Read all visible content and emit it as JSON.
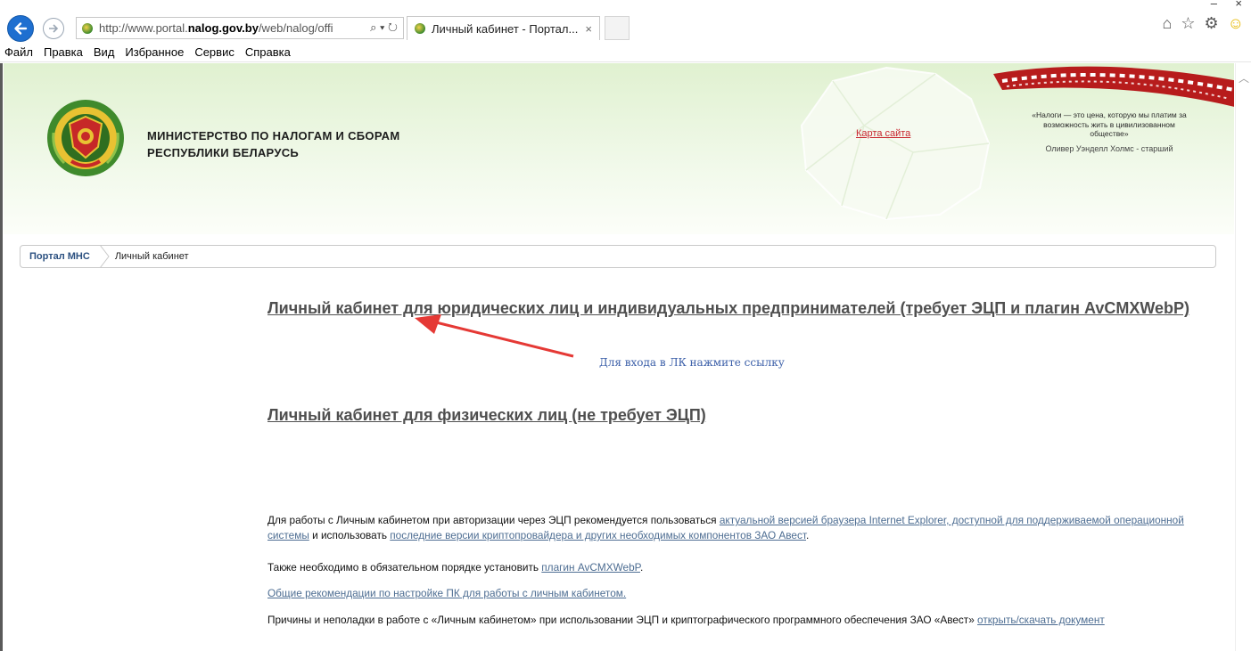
{
  "browser": {
    "address_prefix": "http://www.portal.",
    "address_domain": "nalog.gov.by",
    "address_path": "/web/nalog/offi",
    "address_icons": "⌕ ▾ ↻",
    "tab_title": "Личный кабинет - Портал...",
    "tab_close": "×",
    "window_controls": {
      "minimize": "–",
      "close": "×"
    },
    "tool_icons": {
      "home": "⌂",
      "favorites": "☆",
      "settings": "⚙",
      "feedback": "☺"
    }
  },
  "menu": [
    "Файл",
    "Правка",
    "Вид",
    "Избранное",
    "Сервис",
    "Справка"
  ],
  "header": {
    "ministry_line1": "МИНИСТЕРСТВО ПО НАЛОГАМ И СБОРАМ",
    "ministry_line2": "РЕСПУБЛИКИ БЕЛАРУСЬ",
    "sitemap": "Карта сайта",
    "quote": "«Налоги — это цена, которую мы платим за возможность жить в цивилизованном обществе»",
    "quote_author": "Оливер Уэнделл Холмс - старший"
  },
  "breadcrumb": {
    "home": "Портал МНС",
    "current": "Личный кабинет"
  },
  "content": {
    "link_legal": "Личный кабинет для юридических лиц и индивидуальных предпринимателей (требует ЭЦП и плагин AvCMXWebP)",
    "hint": "Для входа в ЛК нажмите ссылку",
    "link_individual": "Личный кабинет для физических лиц (не требует ЭЦП)",
    "info1_a": "Для работы с Личным кабинетом при авторизации через ЭЦП рекомендуется пользоваться ",
    "info1_link1": "актуальной версией браузера Internet Explorer, доступной для поддерживаемой операционной системы",
    "info1_b": " и использовать ",
    "info1_link2": "последние версии криптопровайдера и других необходимых компонентов ЗАО Авест",
    "info1_c": ".",
    "info2_a": "Также необходимо в обязательном порядке установить ",
    "info2_link": "плагин AvCMXWebP",
    "info2_b": ".",
    "info3_link": "Общие рекомендации по настройке ПК для работы с личным кабинетом.",
    "info4_a": "Причины и неполадки в работе с «Личным кабинетом» при использовании ЭЦП и криптографического программного обеспечения ЗАО «Авест» ",
    "info4_link": "открыть/скачать документ"
  },
  "colors": {
    "header_green": "#e0f1d0",
    "link_gray": "#4f4f4f",
    "hint_blue": "#3a5ea8",
    "arrow_red": "#e53935",
    "sitemap_red": "#c8262e",
    "breadcrumb_blue": "#2b5080"
  }
}
